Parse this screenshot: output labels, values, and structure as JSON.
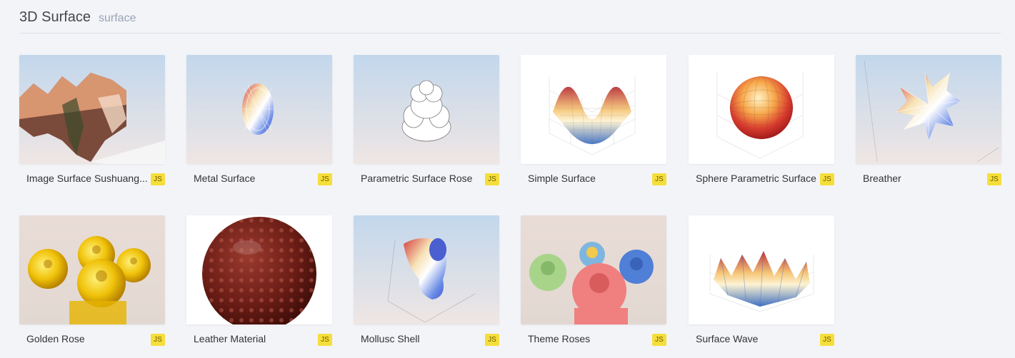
{
  "header": {
    "title": "3D Surface",
    "subtitle": "surface"
  },
  "examples": [
    {
      "title": "Image Surface Sushuang...",
      "badge": "JS"
    },
    {
      "title": "Metal Surface",
      "badge": "JS"
    },
    {
      "title": "Parametric Surface Rose",
      "badge": "JS"
    },
    {
      "title": "Simple Surface",
      "badge": "JS"
    },
    {
      "title": "Sphere Parametric Surface",
      "badge": "JS"
    },
    {
      "title": "Breather",
      "badge": "JS"
    },
    {
      "title": "Golden Rose",
      "badge": "JS"
    },
    {
      "title": "Leather Material",
      "badge": "JS"
    },
    {
      "title": "Mollusc Shell",
      "badge": "JS"
    },
    {
      "title": "Theme Roses",
      "badge": "JS"
    },
    {
      "title": "Surface Wave",
      "badge": "JS"
    }
  ],
  "colors": {
    "page_bg": "#f3f4f8",
    "badge_bg": "#f5de3a",
    "sky_top": "#c2d7ec",
    "sky_bottom": "#ece6e6"
  }
}
